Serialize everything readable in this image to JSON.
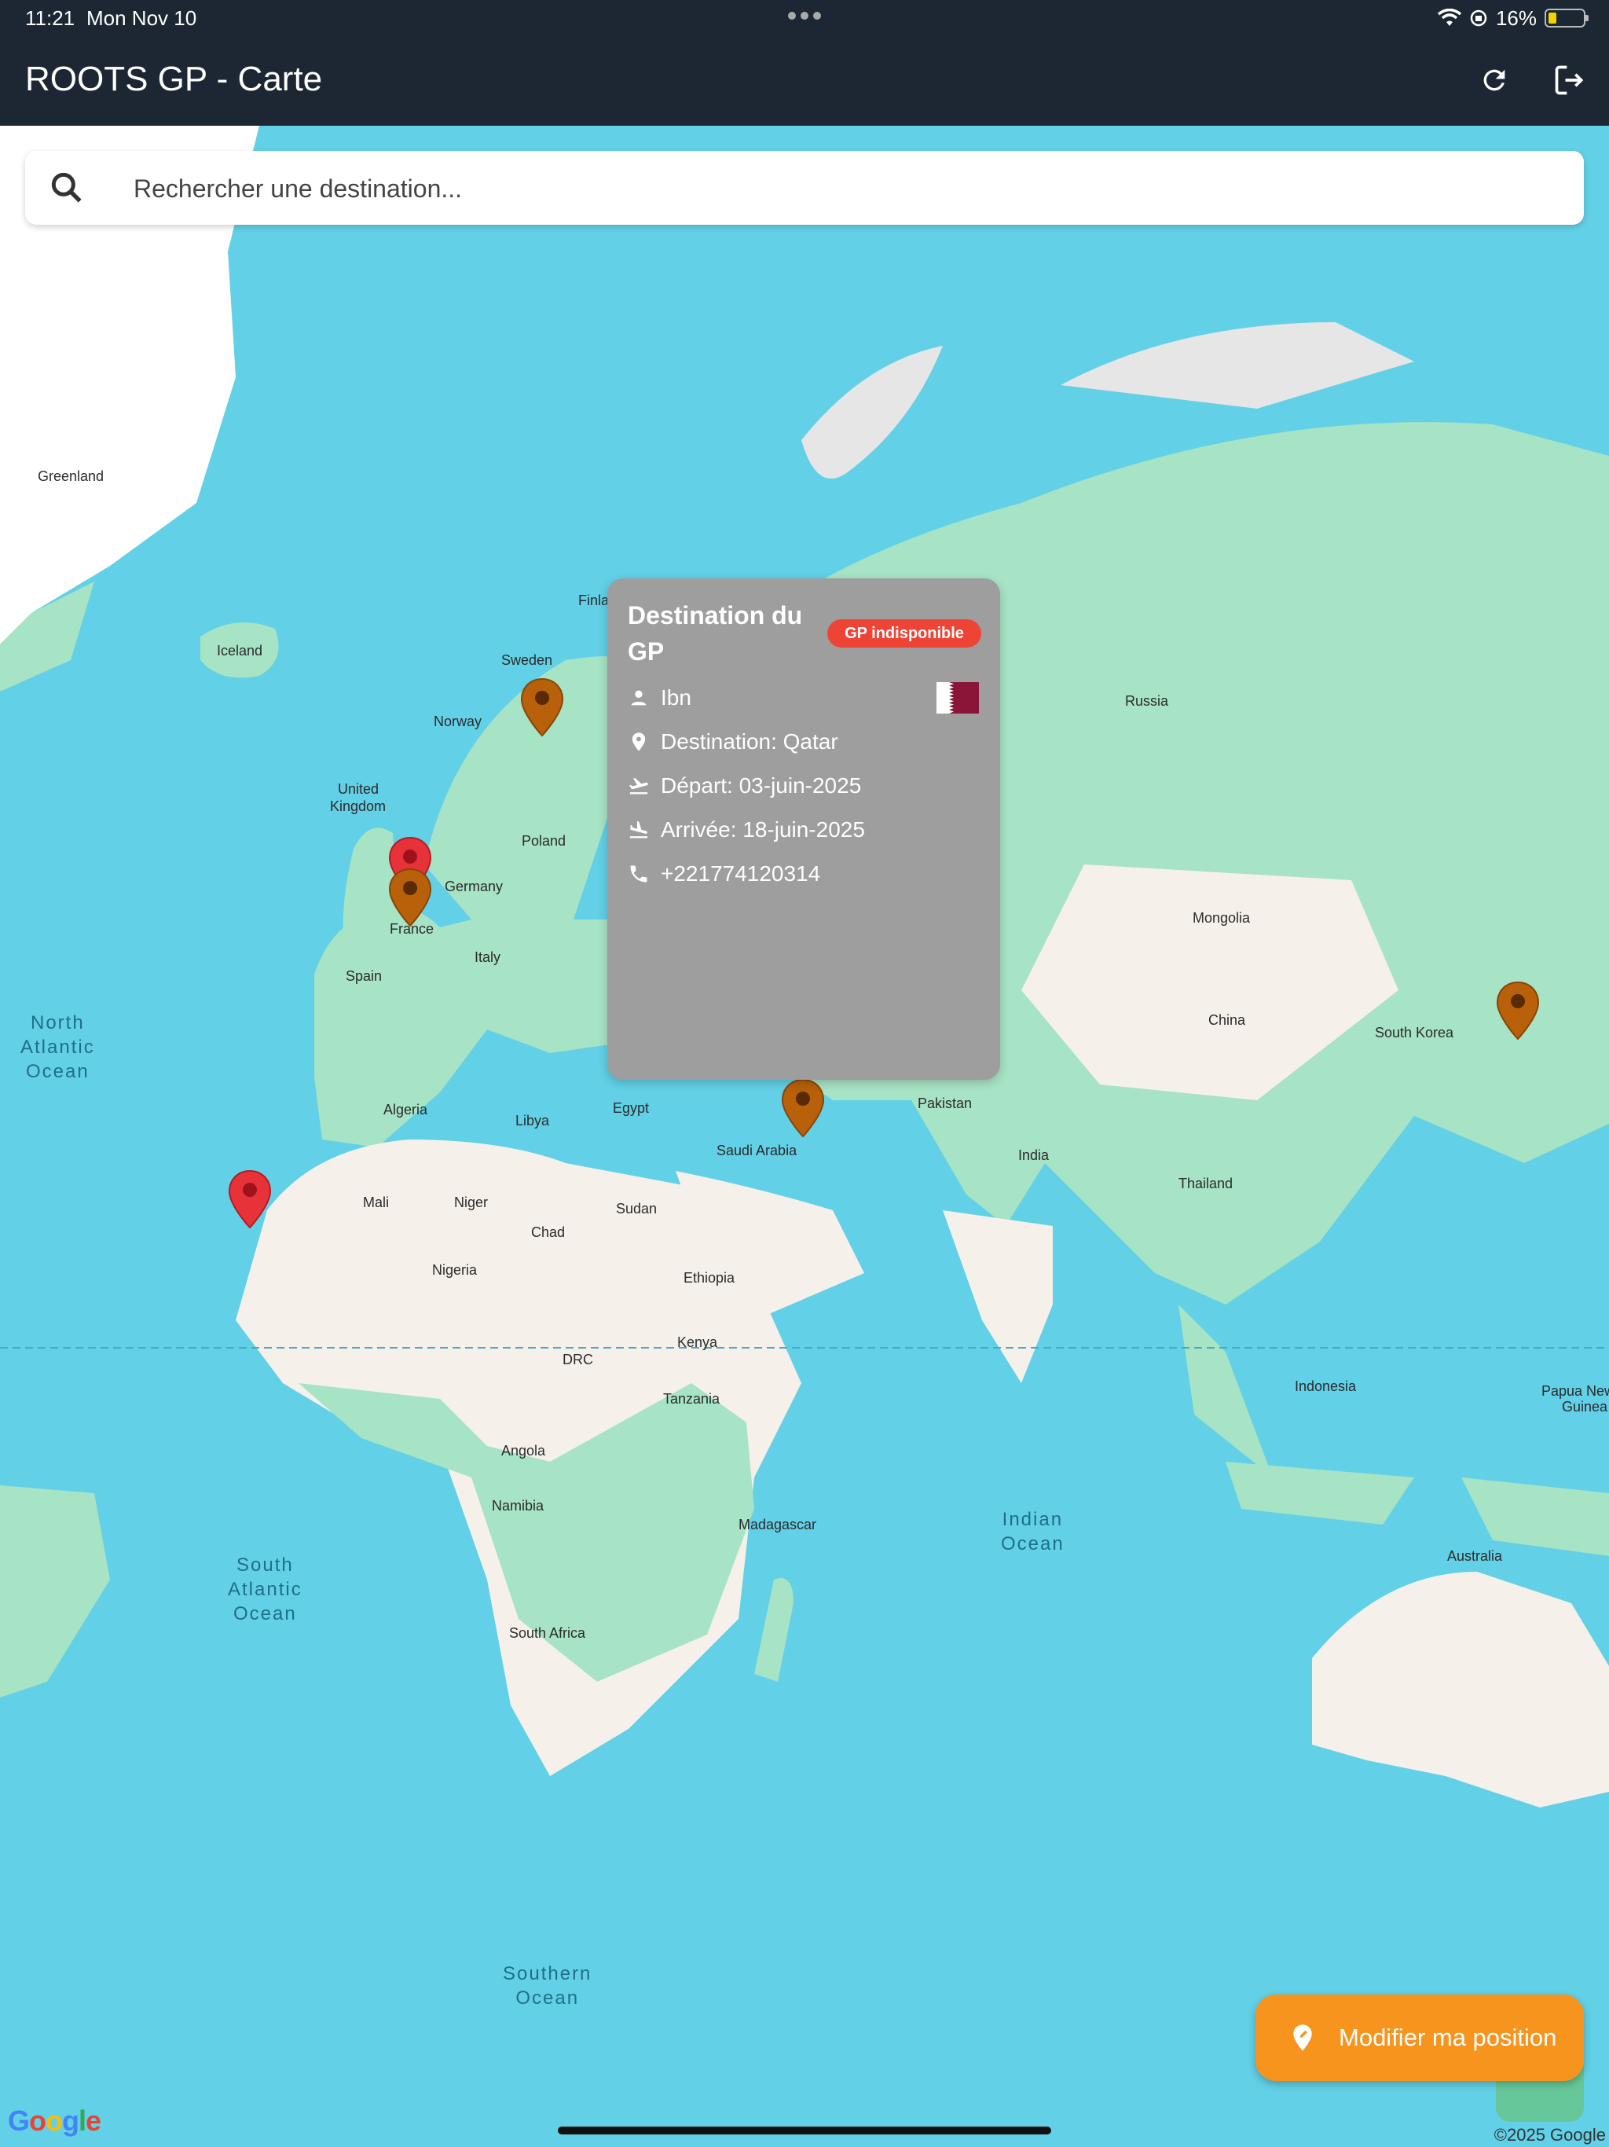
{
  "status_bar": {
    "time": "11:21",
    "date": "Mon Nov 10",
    "battery": "16%",
    "battery_level": 0.16
  },
  "app_bar": {
    "title": "ROOTS GP - Carte",
    "refresh_icon": "refresh-icon",
    "logout_icon": "logout-icon"
  },
  "search": {
    "placeholder": "Rechercher une destination...",
    "value": ""
  },
  "map": {
    "countries": [
      "Greenland",
      "Iceland",
      "Norway",
      "Sweden",
      "Finla",
      "United",
      "Kingdom",
      "Poland",
      "Germany",
      "France",
      "Italy",
      "Spain",
      "Russia",
      "Mongolia",
      "China",
      "South Korea",
      "Algeria",
      "Libya",
      "Egypt",
      "Saudi Arabia",
      "Pakistan",
      "India",
      "Thailand",
      "Mali",
      "Niger",
      "Chad",
      "Sudan",
      "Nigeria",
      "Ethiopia",
      "Kenya",
      "DRC",
      "Tanzania",
      "Angola",
      "Namibia",
      "Madagascar",
      "South Africa",
      "Indonesia",
      "Papua New",
      "Guinea",
      "Australia"
    ],
    "oceans": {
      "north_atlantic": [
        "North",
        "Atlantic",
        "Ocean"
      ],
      "south_atlantic": [
        "South",
        "Atlantic",
        "Ocean"
      ],
      "indian": [
        "Indian",
        "Ocean"
      ],
      "southern": [
        "Southern",
        "Ocean"
      ]
    },
    "attribution_logo": "Google",
    "copyright": "©2025 Google"
  },
  "pins": [
    {
      "color": "#b8600a",
      "status": "orange"
    },
    {
      "color": "#e8323a",
      "status": "red"
    },
    {
      "color": "#b8600a",
      "status": "orange"
    },
    {
      "color": "#b8600a",
      "status": "orange"
    },
    {
      "color": "#b8600a",
      "status": "orange"
    },
    {
      "color": "#e8323a",
      "status": "red"
    }
  ],
  "info_card": {
    "title": "Destination du GP",
    "badge": "GP indisponible",
    "badge_color": "#ee4436",
    "name": "Ibn",
    "destination": "Destination: Qatar",
    "departure": "Départ: 03-juin-2025",
    "arrival": "Arrivée: 18-juin-2025",
    "phone": "+221774120314",
    "flag": "qatar-flag"
  },
  "fab": {
    "label": "Modifier ma position",
    "color": "#f7941d"
  }
}
